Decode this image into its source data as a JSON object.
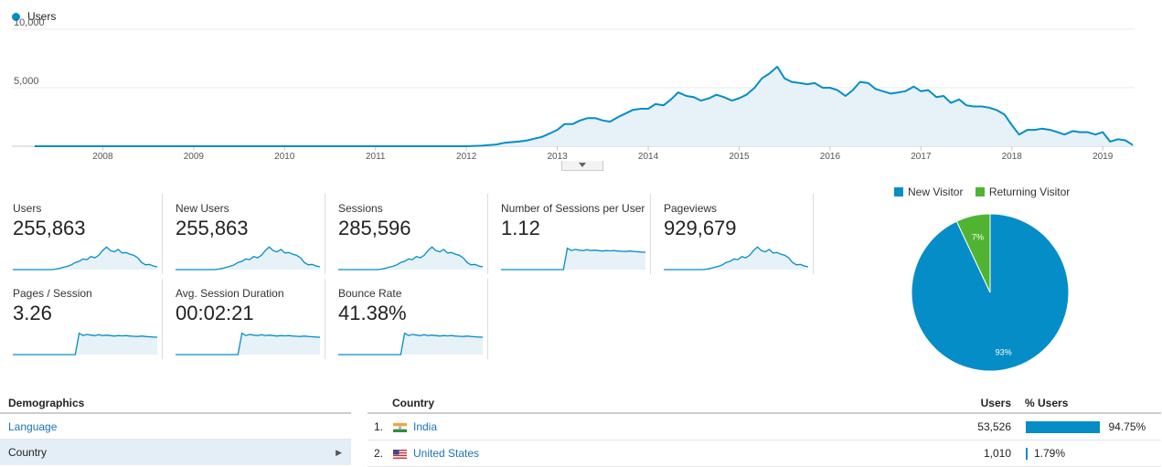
{
  "colors": {
    "primary": "#058dc7",
    "secondary": "#50b432",
    "fill": "#e6f2f8",
    "grid": "#e8e8e8"
  },
  "chart_data": [
    {
      "type": "line",
      "series": [
        {
          "name": "Users",
          "x": [
            2007.25,
            2007.5,
            2008.0,
            2008.5,
            2009.0,
            2009.5,
            2010.0,
            2010.5,
            2011.0,
            2011.5,
            2012.0,
            2012.17,
            2012.33,
            2012.42,
            2012.5,
            2012.58,
            2012.67,
            2012.75,
            2012.83,
            2012.92,
            2013.0,
            2013.08,
            2013.17,
            2013.25,
            2013.33,
            2013.42,
            2013.5,
            2013.58,
            2013.67,
            2013.75,
            2013.83,
            2013.92,
            2014.0,
            2014.08,
            2014.17,
            2014.25,
            2014.33,
            2014.42,
            2014.5,
            2014.58,
            2014.67,
            2014.75,
            2014.83,
            2014.92,
            2015.0,
            2015.08,
            2015.17,
            2015.25,
            2015.33,
            2015.42,
            2015.5,
            2015.58,
            2015.67,
            2015.75,
            2015.83,
            2015.92,
            2016.0,
            2016.08,
            2016.17,
            2016.25,
            2016.33,
            2016.42,
            2016.5,
            2016.58,
            2016.67,
            2016.75,
            2016.83,
            2016.92,
            2017.0,
            2017.08,
            2017.17,
            2017.25,
            2017.33,
            2017.42,
            2017.5,
            2017.58,
            2017.67,
            2017.75,
            2017.83,
            2017.92,
            2018.0,
            2018.08,
            2018.17,
            2018.25,
            2018.33,
            2018.42,
            2018.5,
            2018.58,
            2018.67,
            2018.75,
            2018.83,
            2018.92,
            2019.0,
            2019.08,
            2019.17,
            2019.25,
            2019.33
          ],
          "values": [
            0,
            0,
            0,
            0,
            0,
            0,
            0,
            0,
            0,
            0,
            0,
            50,
            150,
            300,
            350,
            400,
            500,
            650,
            800,
            1100,
            1400,
            1900,
            1900,
            2200,
            2400,
            2400,
            2200,
            2100,
            2500,
            2800,
            3100,
            3200,
            3200,
            3600,
            3500,
            4000,
            4600,
            4300,
            4200,
            3900,
            4100,
            4400,
            4200,
            3900,
            4100,
            4400,
            5000,
            5800,
            6200,
            6800,
            5800,
            5500,
            5400,
            5300,
            5400,
            5000,
            5000,
            4800,
            4300,
            4800,
            5500,
            5400,
            4900,
            4700,
            4500,
            4600,
            4700,
            5100,
            4700,
            4800,
            4200,
            4300,
            3700,
            4000,
            3500,
            3400,
            3400,
            3300,
            3100,
            2700,
            1800,
            1000,
            1400,
            1400,
            1500,
            1400,
            1200,
            1000,
            1300,
            1200,
            1200,
            1000,
            1200,
            400,
            600,
            500,
            100
          ]
        }
      ],
      "x_ticks": [
        "2008",
        "2009",
        "2010",
        "2011",
        "2012",
        "2013",
        "2014",
        "2015",
        "2016",
        "2017",
        "2018",
        "2019"
      ],
      "y_ticks": [
        "10,000",
        "5,000"
      ],
      "xlim": [
        2007.0,
        2019.35
      ],
      "ylim": [
        0,
        10000
      ],
      "legend": "top-left",
      "grid": true
    },
    {
      "type": "pie",
      "slices": [
        {
          "label": "New Visitor",
          "value": 93,
          "text": "93%"
        },
        {
          "label": "Returning Visitor",
          "value": 7,
          "text": "7%"
        }
      ],
      "legend": "top"
    }
  ],
  "metrics": [
    {
      "label": "Users",
      "value": "255,863",
      "spark": "usage"
    },
    {
      "label": "New Users",
      "value": "255,863",
      "spark": "usage"
    },
    {
      "label": "Sessions",
      "value": "285,596",
      "spark": "usage"
    },
    {
      "label": "Number of Sessions per User",
      "value": "1.12",
      "spark": "step"
    },
    {
      "label": "Pageviews",
      "value": "929,679",
      "spark": "usage"
    },
    {
      "label": "Pages / Session",
      "value": "3.26",
      "spark": "step"
    },
    {
      "label": "Avg. Session Duration",
      "value": "00:02:21",
      "spark": "step"
    },
    {
      "label": "Bounce Rate",
      "value": "41.38%",
      "spark": "step"
    }
  ],
  "demographics": {
    "title": "Demographics",
    "items": [
      {
        "label": "Language"
      },
      {
        "label": "Country"
      }
    ]
  },
  "country_table": {
    "headers": {
      "country": "Country",
      "users": "Users",
      "pct": "% Users"
    },
    "rows": [
      {
        "rank": "1.",
        "country": "India",
        "users": "53,526",
        "pct": "94.75%",
        "share": 94.75,
        "flag": "india-flag-icon"
      },
      {
        "rank": "2.",
        "country": "United States",
        "users": "1,010",
        "pct": "1.79%",
        "share": 1.79,
        "flag": "us-flag-icon"
      }
    ]
  }
}
